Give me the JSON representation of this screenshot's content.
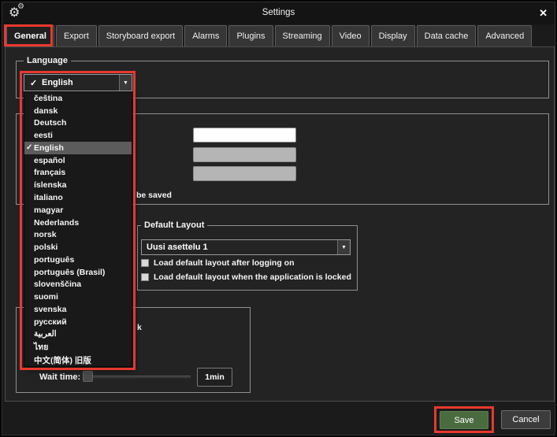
{
  "window": {
    "title": "Settings"
  },
  "icons": {
    "gear": "⚙",
    "close": "✕",
    "dropdown_arrow": "▼",
    "checkmark": "✓"
  },
  "tabs": {
    "selected": "General",
    "items": [
      "General",
      "Export",
      "Storyboard export",
      "Alarms",
      "Plugins",
      "Streaming",
      "Video",
      "Display",
      "Data cache",
      "Advanced"
    ]
  },
  "language": {
    "group_label": "Language",
    "selected_value": "English",
    "selected_index": 4,
    "options": [
      "čeština",
      "dansk",
      "Deutsch",
      "eesti",
      "English",
      "español",
      "français",
      "íslenska",
      "italiano",
      "magyar",
      "Nederlands",
      "norsk",
      "polski",
      "português",
      "português (Brasil)",
      "slovenščina",
      "suomi",
      "svenska",
      "русский",
      "العربية",
      "ไทย",
      "中文(简体) 旧版"
    ]
  },
  "form_section": {
    "visible_text_fragment": "be saved",
    "inputs": [
      {
        "value": "",
        "state": "enabled"
      },
      {
        "value": "",
        "state": "disabled"
      },
      {
        "value": "",
        "state": "disabled"
      }
    ]
  },
  "default_layout": {
    "group_label": "Default Layout",
    "dropdown_value": "Uusi asettelu 1",
    "checkbox_1": "Load default layout after logging on",
    "checkbox_2": "Load default layout when the application is locked"
  },
  "lock_section": {
    "visible_text_fragment": "k",
    "wait_time_label": "Wait time:",
    "wait_time_value": "1min"
  },
  "footer": {
    "save_label": "Save",
    "cancel_label": "Cancel"
  },
  "colors": {
    "annotation_red": "#e8392f",
    "save_green": "#4a6b3f",
    "selected_row_gray": "#5c5c5c"
  }
}
